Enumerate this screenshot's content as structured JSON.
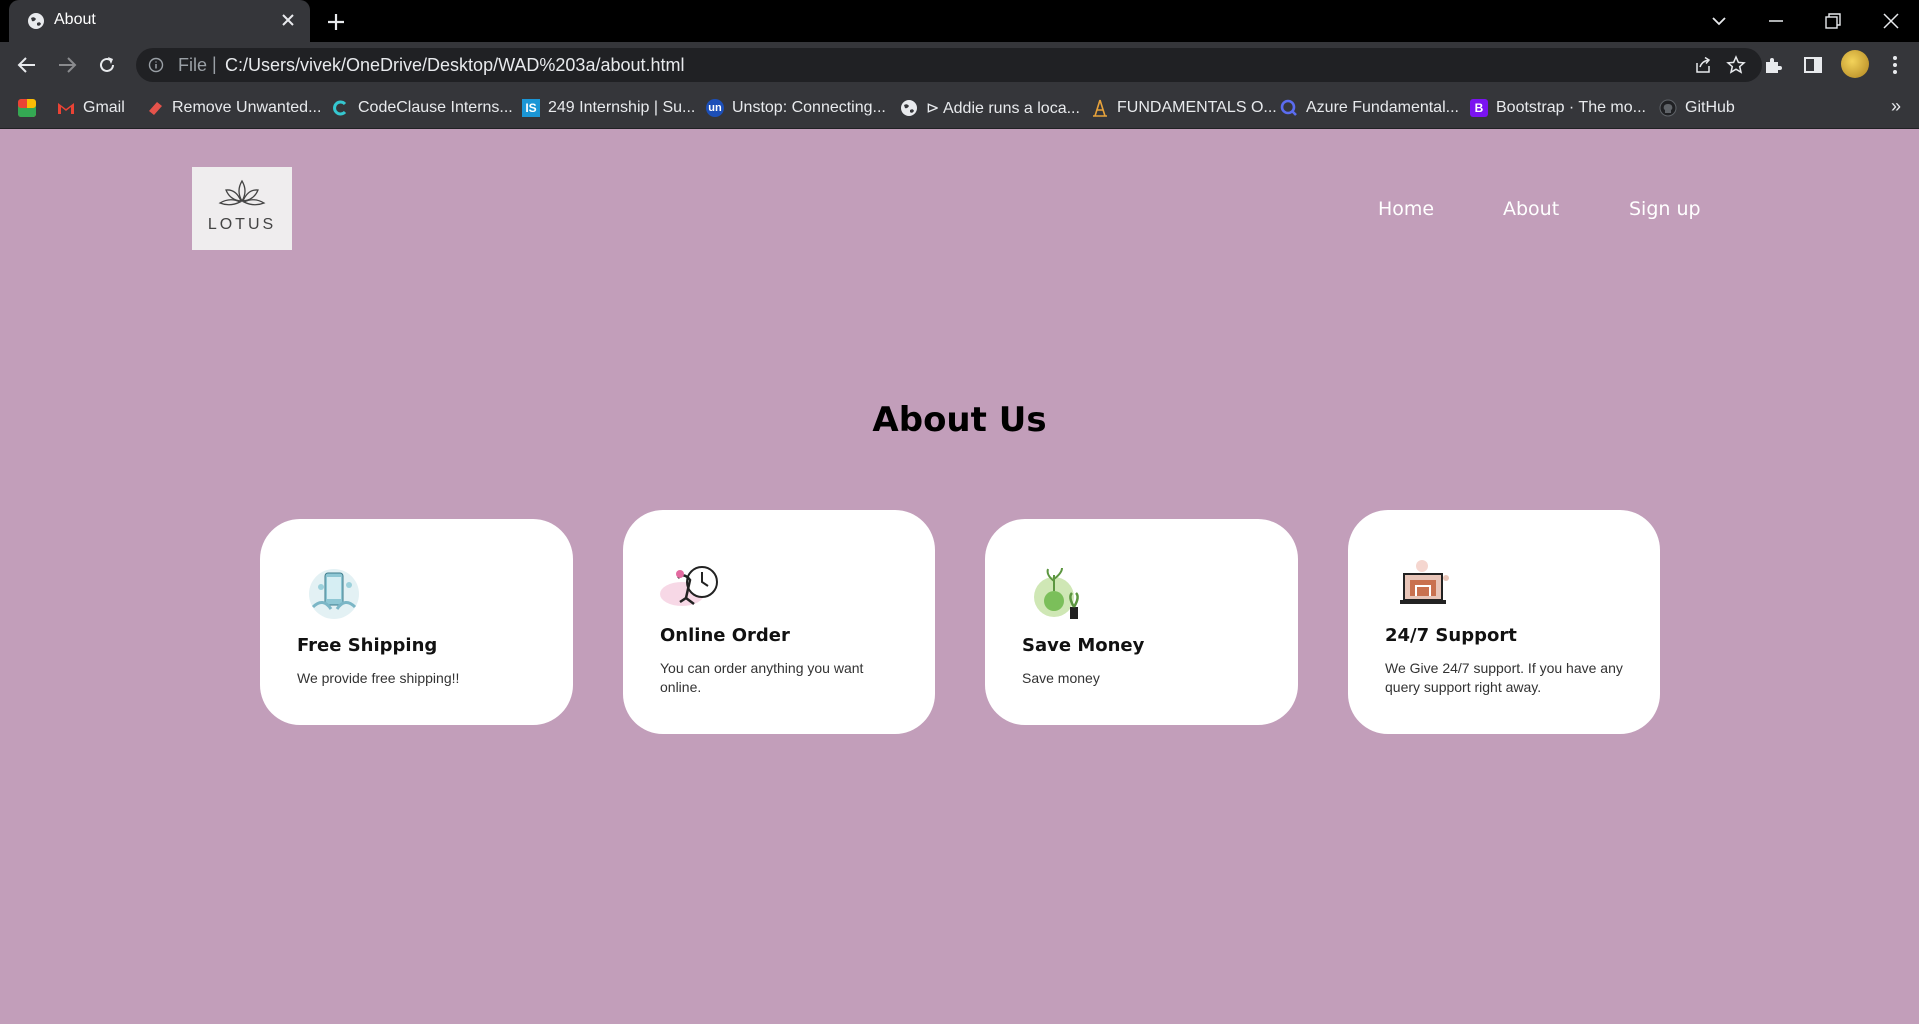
{
  "browser": {
    "tab_title": "About",
    "url_scheme": "File",
    "url": "C:/Users/vivek/OneDrive/Desktop/WAD%203a/about.html",
    "bookmarks": [
      {
        "label": "",
        "icon": "apps-grid-icon"
      },
      {
        "label": "Gmail",
        "icon": "gmail-icon"
      },
      {
        "label": "Remove Unwanted...",
        "icon": "eraser-icon"
      },
      {
        "label": "CodeClause Interns...",
        "icon": "codeclause-icon"
      },
      {
        "label": "249 Internship | Su...",
        "icon": "internshala-icon"
      },
      {
        "label": "Unstop: Connecting...",
        "icon": "unstop-icon"
      },
      {
        "label": "⊳ Addie runs a loca...",
        "icon": "globe-icon"
      },
      {
        "label": "FUNDAMENTALS O...",
        "icon": "tower-icon"
      },
      {
        "label": "Azure Fundamental...",
        "icon": "search-circle-icon"
      },
      {
        "label": "Bootstrap · The mo...",
        "icon": "bootstrap-icon"
      },
      {
        "label": "GitHub",
        "icon": "github-icon"
      }
    ],
    "more_bookmarks": "»"
  },
  "site": {
    "logo_text": "LOTUS",
    "nav": [
      "Home",
      "About",
      "Sign up"
    ]
  },
  "page": {
    "title": "About Us",
    "cards": [
      {
        "title": "Free Shipping",
        "text": "We provide free shipping!!",
        "icon": "shipping-phone-icon"
      },
      {
        "title": "Online Order",
        "text": "You can order anything you want online.",
        "icon": "clock-order-icon"
      },
      {
        "title": "Save Money",
        "text": "Save money",
        "icon": "money-plant-icon"
      },
      {
        "title": "24/7 Support",
        "text": "We Give 24/7 support. If you have any query support right away.",
        "icon": "support-laptop-icon"
      }
    ]
  },
  "colors": {
    "page_background": "#c29eba",
    "card_background": "#ffffff",
    "logo_background": "#efedee"
  }
}
